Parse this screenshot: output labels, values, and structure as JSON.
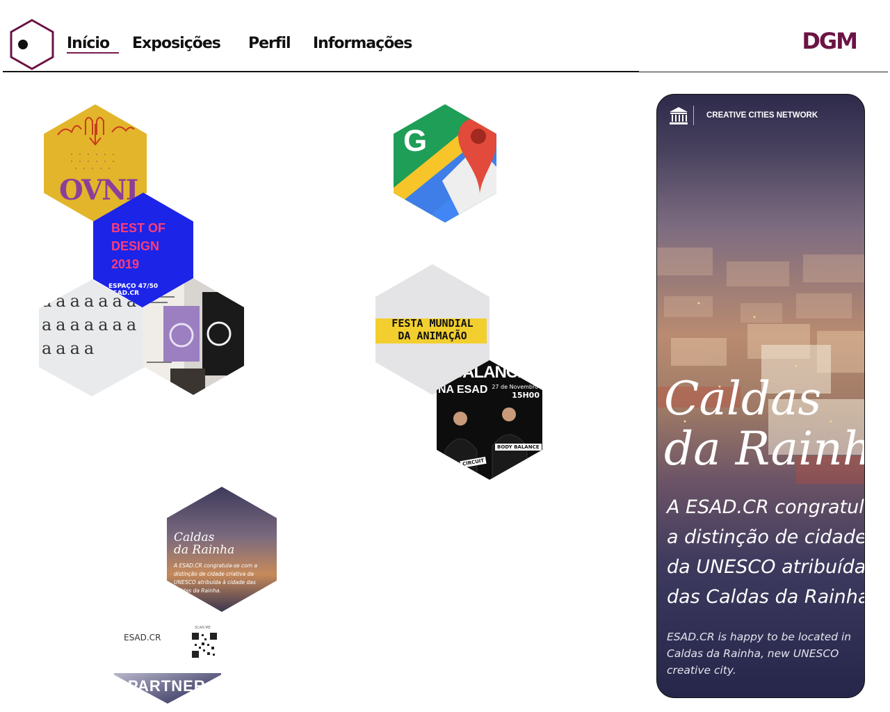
{
  "header": {
    "nav": [
      "Início",
      "Exposições",
      "Perfil",
      "Informações"
    ],
    "brand": "DGM",
    "colors": {
      "accent": "#6b1444",
      "rule": "#111111"
    }
  },
  "tiles": {
    "ovni": {
      "word": "OVNI"
    },
    "best_of_design": {
      "title": "BEST OF DESIGN 2019",
      "line1": "ESPAÇO 47/50",
      "line2": "ESAD.CR"
    },
    "letters": {
      "glyphs": "aaaaaaaaaaaaaaaaaa"
    },
    "google_maps": {
      "icon": "google-maps-icon",
      "letter": "G"
    },
    "festa": {
      "line1": "FESTA MUNDIAL",
      "line2": "DA ANIMAÇÃO"
    },
    "body_balance": {
      "top": "BALANCE",
      "esad": "NA ESAD",
      "date": "27 de Novembro",
      "hour": "15H00",
      "tag": "BODY BALANCE",
      "circuit": "CIRCUIT"
    },
    "caldas_small": {
      "title_l1": "Caldas",
      "title_l2": "da Rainha",
      "text": "A ESAD.CR congratula-se com a distinção de cidade criativa da UNESCO atribuída à cidade das Caldas da Rainha."
    },
    "partner": {
      "esad": "ESAD.CR",
      "scan": "SCAN ME",
      "word": "PARTNER"
    }
  },
  "banner": {
    "unesco_label": "CREATIVE CITIES NETWORK",
    "title_l1": "Caldas",
    "title_l2": "da Rainha",
    "body": [
      "A ESAD.CR congratula-se com",
      "a distinção de cidade criativa",
      "da UNESCO atribuída à cidade",
      "das Caldas da Rainha."
    ],
    "foot": "ESAD.CR is happy to be located in Caldas da Rainha, new UNESCO creative city."
  }
}
